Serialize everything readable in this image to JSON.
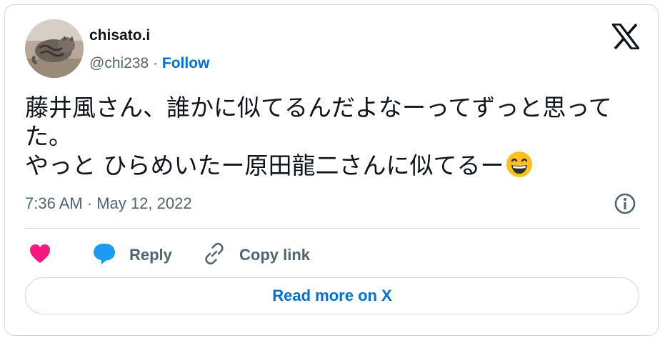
{
  "author": {
    "display_name": "chisato.i",
    "handle": "@chi238",
    "separator": "·",
    "follow_label": "Follow",
    "avatar_icon": "cat-photo-avatar"
  },
  "brand": {
    "logo_icon": "x-logo-icon"
  },
  "tweet": {
    "lines": [
      "藤井風さん、誰かに似てるんだよなーってずっと思って",
      "た。",
      "やっと ひらめいたー原田龍二さんに似てるー"
    ],
    "emoji": "grinning-face-with-smiling-eyes"
  },
  "meta": {
    "timestamp": "7:36 AM · May 12, 2022"
  },
  "actions": {
    "like_icon": "heart-icon",
    "reply_label": "Reply",
    "copy_label": "Copy link"
  },
  "footer": {
    "read_more_label": "Read more on X"
  },
  "colors": {
    "accent": "#006fd6",
    "like": "#f91880",
    "reply": "#1d9bf0",
    "muted": "#536471",
    "border": "#cfd9de"
  }
}
